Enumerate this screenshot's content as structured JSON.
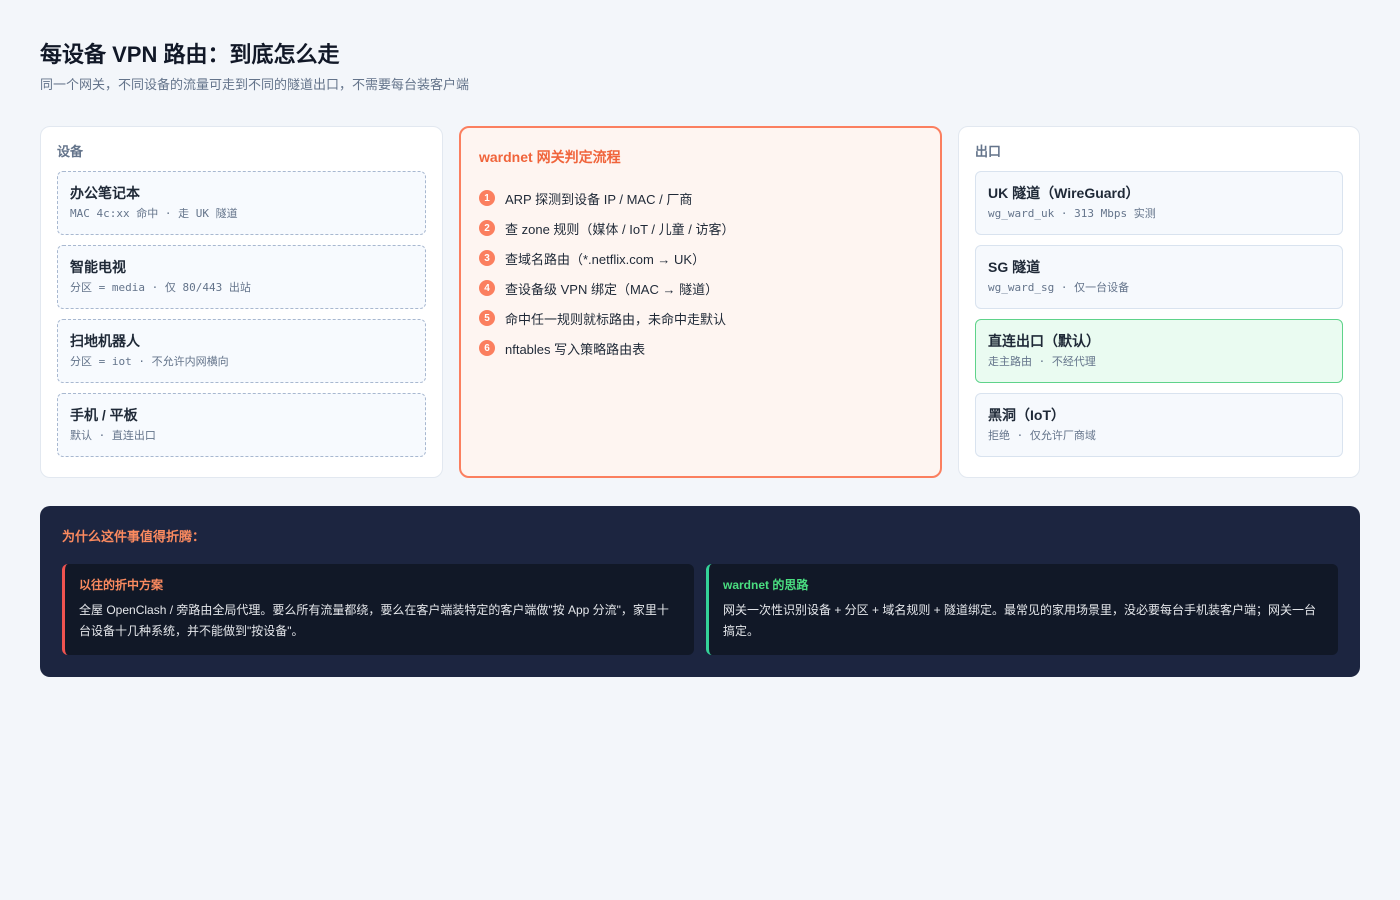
{
  "header": {
    "title": "每设备 VPN 路由：到底怎么走",
    "subtitle": "同一个网关，不同设备的流量可走到不同的隧道出口，不需要每台装客户端"
  },
  "devices": {
    "heading": "设备",
    "items": [
      {
        "name": "办公笔记本",
        "detail": "MAC 4c:xx 命中 · 走 UK 隧道"
      },
      {
        "name": "智能电视",
        "detail": "分区 = media · 仅 80/443 出站"
      },
      {
        "name": "扫地机器人",
        "detail": "分区 = iot · 不允许内网横向"
      },
      {
        "name": "手机 / 平板",
        "detail": "默认 · 直连出口"
      }
    ]
  },
  "flow": {
    "title": "wardnet 网关判定流程",
    "steps": [
      {
        "num": "1",
        "text": "ARP 探测到设备 IP / MAC / 厂商"
      },
      {
        "num": "2",
        "text": "查 zone 规则（媒体 / IoT / 儿童 / 访客）"
      },
      {
        "num": "3",
        "text": "查域名路由（*.netflix.com → UK）"
      },
      {
        "num": "4",
        "text": "查设备级 VPN 绑定（MAC → 隧道）"
      },
      {
        "num": "5",
        "text": "命中任一规则就标路由，未命中走默认"
      },
      {
        "num": "6",
        "text": "nftables 写入策略路由表"
      }
    ]
  },
  "exits": {
    "heading": "出口",
    "items": [
      {
        "name": "UK 隧道（WireGuard）",
        "detail": "wg_ward_uk · 313 Mbps 实测"
      },
      {
        "name": "SG 隧道",
        "detail": "wg_ward_sg · 仅一台设备"
      },
      {
        "name": "直连出口（默认）",
        "detail": "走主路由 · 不经代理"
      },
      {
        "name": "黑洞（IoT）",
        "detail": "拒绝 · 仅允许厂商域"
      }
    ]
  },
  "why": {
    "title": "为什么这件事值得折腾：",
    "old": {
      "title": "以往的折中方案",
      "text": "全屋 OpenClash / 旁路由全局代理。要么所有流量都绕，要么在客户端装特定的客户端做\"按 App 分流\"，家里十台设备十几种系统，并不能做到\"按设备\"。"
    },
    "new": {
      "title": "wardnet 的思路",
      "text": "网关一次性识别设备 + 分区 + 域名规则 + 隧道绑定。最常见的家用场景里，没必要每台手机装客户端；网关一台搞定。"
    }
  },
  "colors": {
    "accent": "#fb7f5f",
    "flow_bg": "#fef5f1",
    "default_exit": "#5fd38a",
    "dark_panel": "#1c2540"
  }
}
